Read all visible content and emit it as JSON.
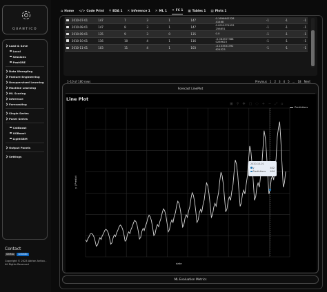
{
  "brand": {
    "name": "QUANTICO"
  },
  "sidebar": {
    "items": [
      {
        "label": "Load & Save",
        "type": "section"
      },
      {
        "label": "Local",
        "type": "sub"
      },
      {
        "label": "Sessions",
        "type": "sub"
      },
      {
        "label": "PostGRE",
        "type": "sub"
      },
      {
        "label": "Data Wrangling",
        "type": "section"
      },
      {
        "label": "Feature Engineering",
        "type": "section"
      },
      {
        "label": "Unsupervised Learning",
        "type": "section"
      },
      {
        "label": "Machine Learning",
        "type": "section"
      },
      {
        "label": "ML Scoring",
        "type": "section"
      },
      {
        "label": "Inference",
        "type": "section"
      },
      {
        "label": "Forecasting",
        "type": "section"
      },
      {
        "label": "Single Series",
        "type": "section"
      },
      {
        "label": "Panel Series",
        "type": "section"
      },
      {
        "label": "CatBoost",
        "type": "sub"
      },
      {
        "label": "XGBoost",
        "type": "sub"
      },
      {
        "label": "LightGBM",
        "type": "sub"
      },
      {
        "label": "Output Panels",
        "type": "section"
      },
      {
        "label": "Settings",
        "type": "section"
      }
    ],
    "contact": "Contact",
    "badges": {
      "github": "GitHub",
      "linkedin": "LinkedIn"
    },
    "copyright": "Copyright © 2023 Adrian Antico - All Rights Reserved"
  },
  "tabs": [
    {
      "label": "Home",
      "icon": "home-icon",
      "glyph": "⌂"
    },
    {
      "label": "Code Print",
      "icon": "code-icon",
      "glyph": "</>"
    },
    {
      "label": "EDA 1",
      "icon": "search-icon",
      "glyph": "⚲"
    },
    {
      "label": "Inference 1",
      "icon": "wrench-icon",
      "glyph": "✕"
    },
    {
      "label": "ML 1",
      "icon": "wrench-icon",
      "glyph": "✕"
    },
    {
      "label": "FC 1",
      "icon": "wrench-icon",
      "glyph": "✕",
      "active": true
    },
    {
      "label": "Tables 1",
      "icon": "table-icon",
      "glyph": "▦"
    },
    {
      "label": "Plots 1",
      "icon": "chart-icon",
      "glyph": "▤"
    }
  ],
  "table": {
    "rows": [
      [
        "2010-07-01",
        "147",
        "7",
        "3",
        "1",
        "147",
        "0.1696642328\n41468",
        "-1",
        "-1",
        "-1"
      ],
      [
        "2010-08-01",
        "147",
        "8",
        "3",
        "1",
        "147",
        "0.0919374953\n256851",
        "-1",
        "-1",
        "-1"
      ],
      [
        "2010-09-01",
        "135",
        "9",
        "3",
        "0",
        "135",
        "0.0",
        "-1",
        "-1",
        "-1"
      ],
      [
        "2010-10-01",
        "116",
        "10",
        "4",
        "1",
        "116",
        "-0.084557388\n0289623",
        "-1",
        "-1",
        "-1"
      ],
      [
        "2010-11-01",
        "103",
        "11",
        "4",
        "1",
        "103",
        "-0.133531392\n624523",
        "-1",
        "-1",
        "-1"
      ]
    ],
    "rows_info": "1–10 of 180 rows",
    "pager": [
      "Previous",
      "1",
      "2",
      "3",
      "4",
      "5",
      "...",
      "18",
      "Next"
    ]
  },
  "forecast_panel": {
    "card_title": "Forecast LinePlot",
    "plot_title": "Line Plot",
    "legend": "Predictions",
    "tooltip": {
      "date": "2020-10-01",
      "rows": [
        {
          "label": "y",
          "value": "402"
        },
        {
          "label": "Predictions",
          "value": "404"
        }
      ]
    }
  },
  "eval_panel": {
    "title": "ML Evaluation Metrics"
  },
  "chart_data": {
    "type": "line",
    "title": "Line Plot",
    "xlabel": "date",
    "ylabel": "y | Predict",
    "legend": [
      "Predictions"
    ],
    "grid": true,
    "x_start": "2006-01",
    "x_end": "2021-12",
    "frequency": "monthly",
    "series": [
      {
        "name": "Predictions",
        "values": [
          140,
          136,
          143,
          148,
          154,
          155,
          153,
          147,
          137,
          125,
          128,
          138,
          145,
          141,
          150,
          155,
          162,
          165,
          162,
          156,
          145,
          130,
          133,
          145,
          152,
          148,
          157,
          163,
          171,
          175,
          172,
          165,
          153,
          137,
          140,
          153,
          159,
          155,
          165,
          171,
          180,
          186,
          183,
          175,
          161,
          142,
          146,
          160,
          167,
          162,
          173,
          180,
          191,
          198,
          194,
          185,
          169,
          150,
          154,
          168,
          176,
          171,
          183,
          191,
          204,
          213,
          209,
          198,
          180,
          159,
          164,
          179,
          187,
          181,
          195,
          204,
          220,
          231,
          226,
          213,
          193,
          170,
          175,
          191,
          199,
          193,
          208,
          218,
          238,
          251,
          245,
          230,
          207,
          181,
          187,
          204,
          212,
          205,
          222,
          234,
          257,
          274,
          267,
          249,
          222,
          193,
          199,
          217,
          226,
          219,
          237,
          251,
          278,
          299,
          291,
          270,
          238,
          206,
          213,
          232,
          241,
          233,
          253,
          269,
          301,
          328,
          318,
          293,
          256,
          219,
          227,
          248,
          257,
          248,
          270,
          289,
          326,
          361,
          348,
          318,
          275,
          233,
          242,
          265,
          274,
          264,
          288,
          310,
          353,
          397,
          380,
          345,
          295,
          248,
          258,
          283,
          292,
          281,
          306,
          331,
          382,
          404,
          418,
          374,
          316,
          264,
          274,
          301
        ]
      }
    ],
    "xlim": [
      "2006",
      "2021"
    ],
    "ylim": [
      100,
      450
    ],
    "hover": {
      "x": "2020-10-01",
      "y": 402,
      "prediction": 404
    }
  }
}
